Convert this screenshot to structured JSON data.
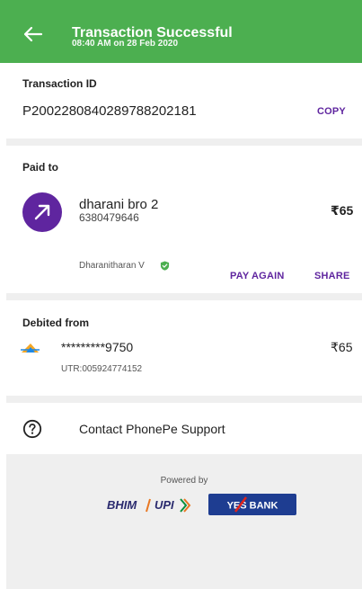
{
  "header": {
    "title": "Transaction Successful",
    "subtitle": "08:40 AM on 28 Feb 2020",
    "colors": {
      "background": "#4caf50"
    }
  },
  "transaction": {
    "label": "Transaction ID",
    "id": "P2002280840289788202181",
    "copy_label": "COPY"
  },
  "paid_to": {
    "label": "Paid to",
    "name": "dharani bro 2",
    "phone": "6380479646",
    "amount": "₹65",
    "verified_name": "Dharanitharan V",
    "pay_again_label": "PAY AGAIN",
    "share_label": "SHARE"
  },
  "debited_from": {
    "label": "Debited from",
    "account": "*********9750",
    "amount": "₹65",
    "utr": "UTR:005924774152"
  },
  "support": {
    "label": "Contact PhonePe Support"
  },
  "footer": {
    "powered_by": "Powered by",
    "logos": {
      "bhim": "BHIM",
      "upi": "UPI",
      "bank": "YES BANK"
    }
  },
  "colors": {
    "accent_purple": "#5f259f",
    "success_green": "#4caf50",
    "separator_gray": "#efefef"
  }
}
